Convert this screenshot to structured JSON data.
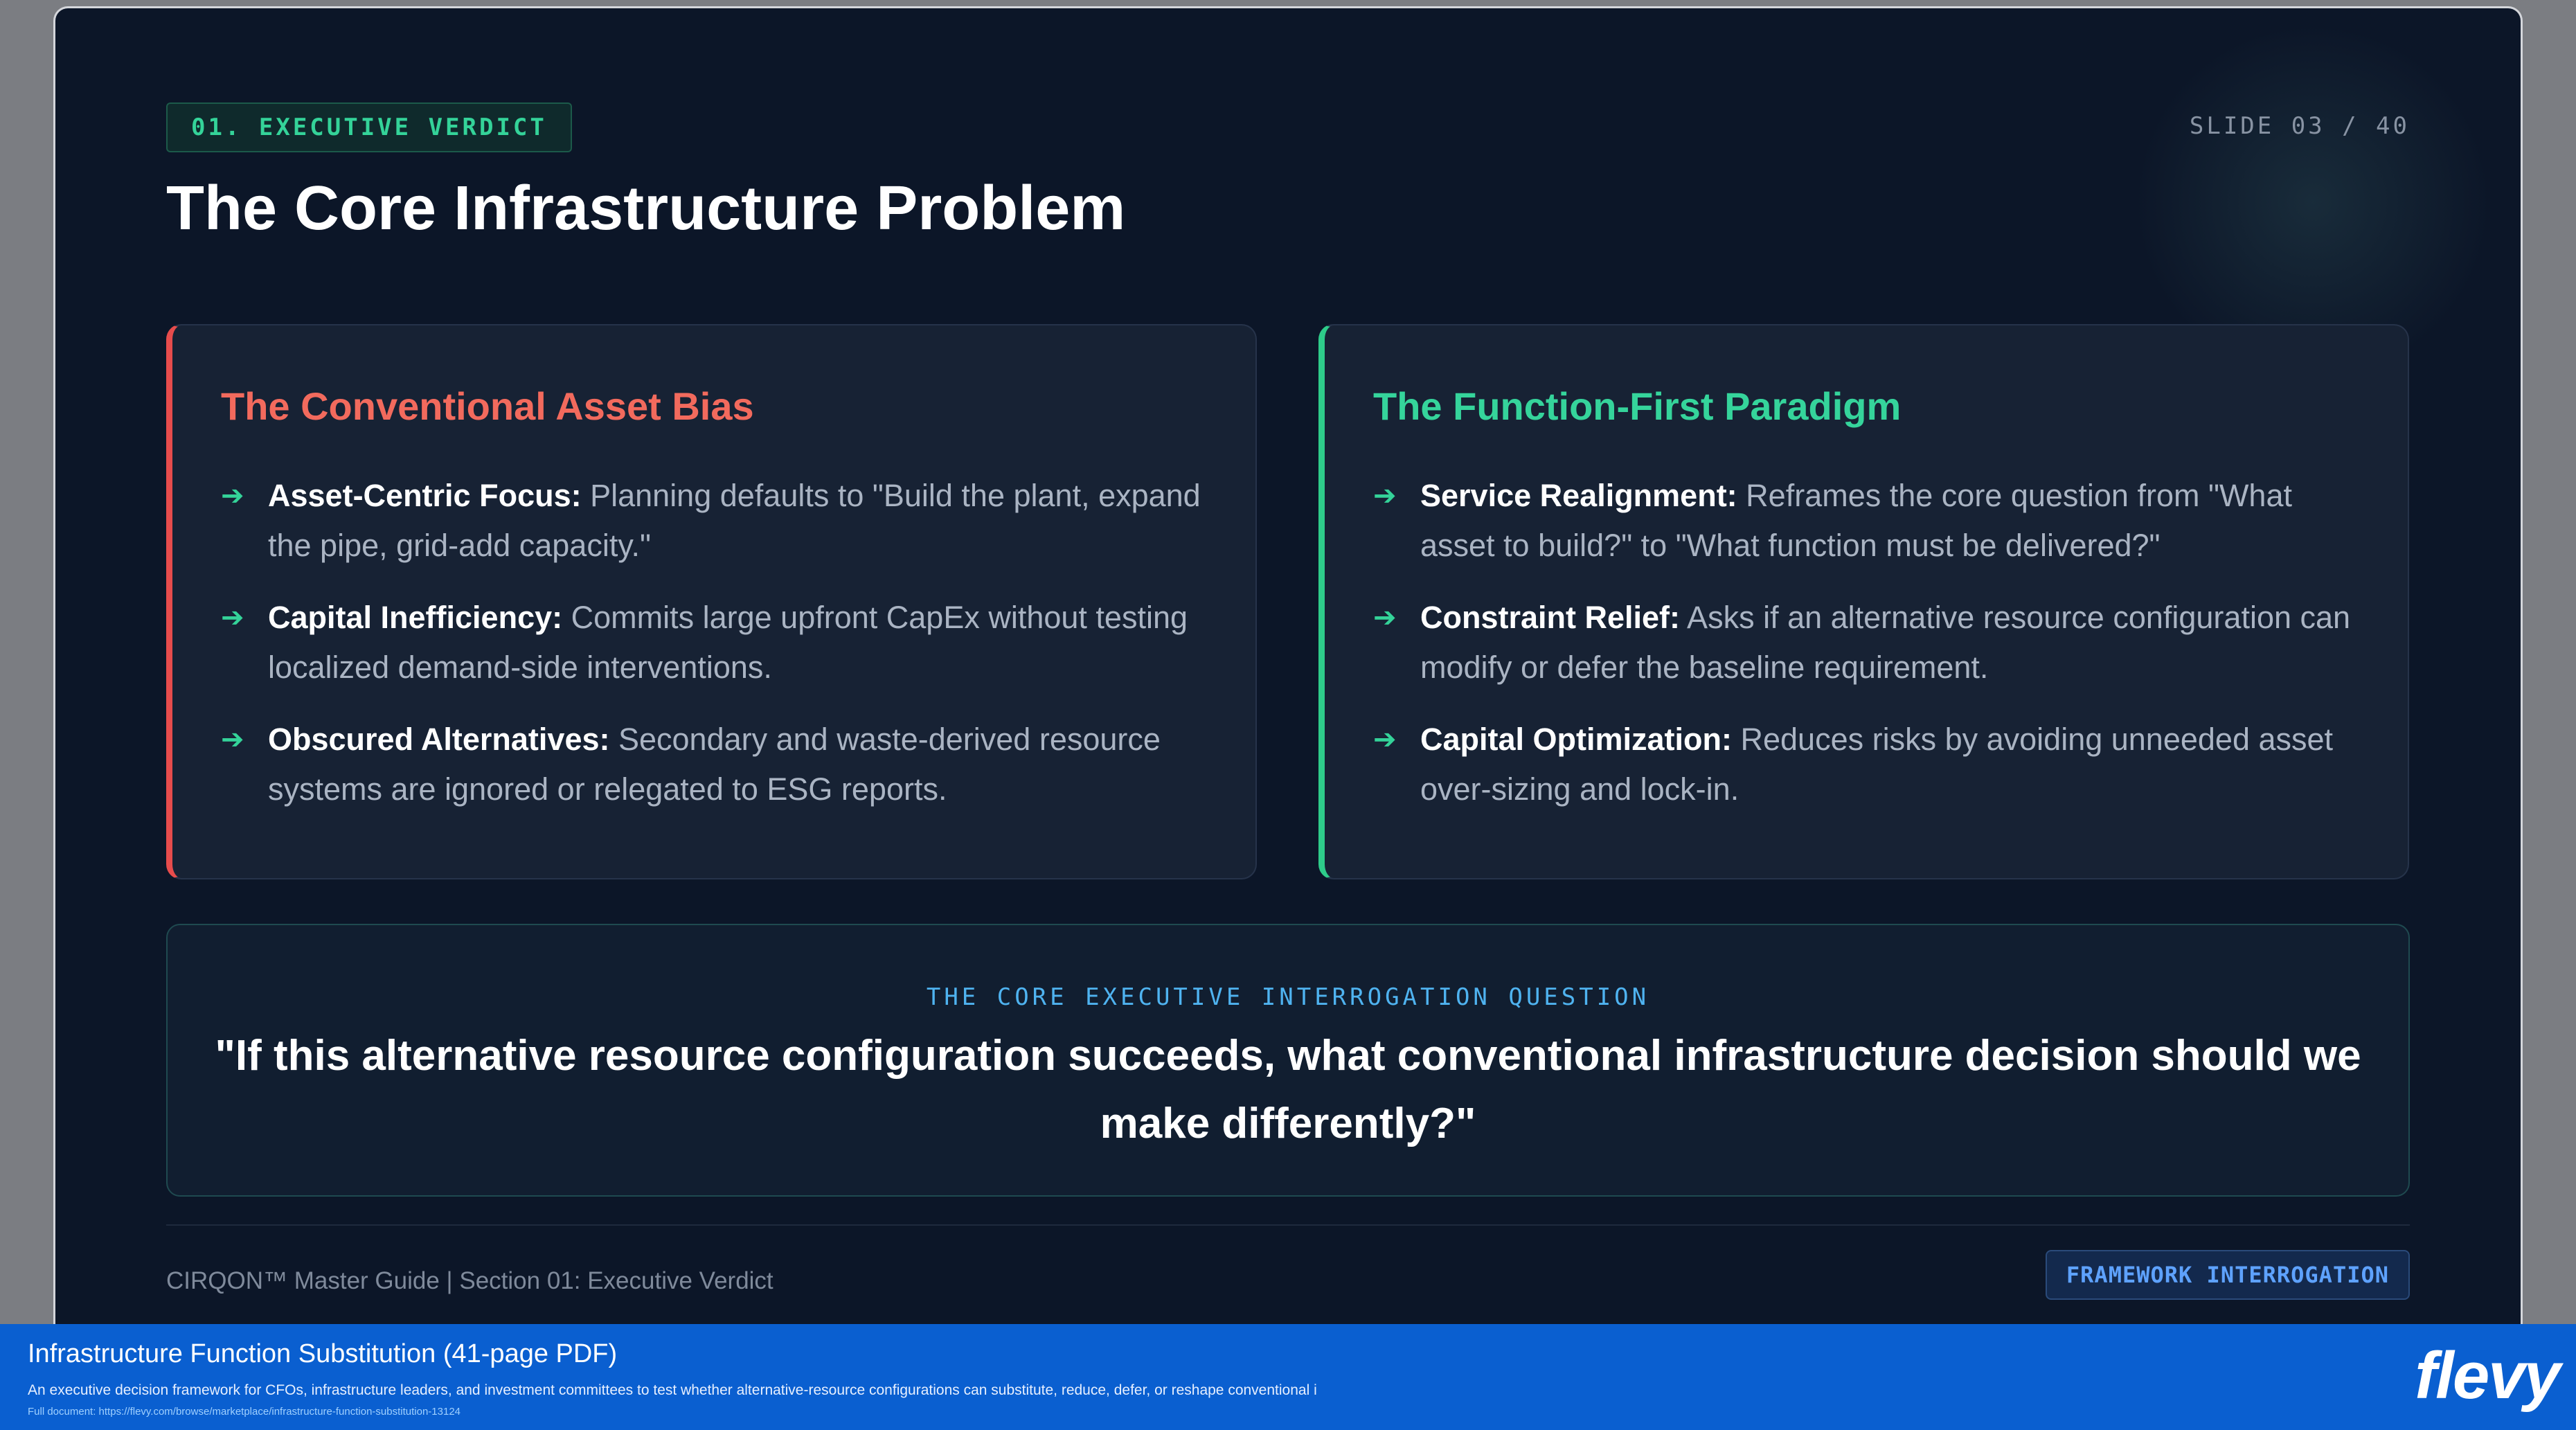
{
  "slide": {
    "tag": "01. EXECUTIVE VERDICT",
    "number": "SLIDE 03 / 40",
    "title": "The Core Infrastructure Problem"
  },
  "left_card": {
    "title": "The Conventional Asset Bias",
    "accent": "#e74c4c",
    "items": [
      {
        "term": "Asset-Centric Focus:",
        "text": " Planning defaults to \"Build the plant, expand the pipe, grid-add capacity.\""
      },
      {
        "term": "Capital Inefficiency:",
        "text": " Commits large upfront CapEx without testing localized demand-side interventions."
      },
      {
        "term": "Obscured Alternatives:",
        "text": " Secondary and waste-derived resource systems are ignored or relegated to ESG reports."
      }
    ]
  },
  "right_card": {
    "title": "The Function-First Paradigm",
    "accent": "#2ecc8a",
    "items": [
      {
        "term": "Service Realignment:",
        "text": " Reframes the core question from \"What asset to build?\" to \"What function must be delivered?\""
      },
      {
        "term": "Constraint Relief:",
        "text": " Asks if an alternative resource configuration can modify or defer the baseline requirement."
      },
      {
        "term": "Capital Optimization:",
        "text": " Reduces risks by avoiding unneeded asset over-sizing and lock-in."
      }
    ]
  },
  "question": {
    "label": "THE CORE EXECUTIVE INTERROGATION QUESTION",
    "text": "\"If this alternative resource configuration succeeds, what conventional infrastructure decision should we make differently?\""
  },
  "footer": {
    "text": "CIRQON™ Master Guide | Section 01: Executive Verdict",
    "badge": "FRAMEWORK INTERROGATION"
  },
  "banner": {
    "title": "Infrastructure Function Substitution",
    "pages": " (41-page PDF)",
    "description": "An executive decision framework for CFOs, infrastructure leaders, and investment committees to test whether alternative-resource configurations can substitute, reduce, defer, or reshape conventional i",
    "link": "Full document: https://flevy.com/browse/marketplace/infrastructure-function-substitution-13124",
    "logo": "flevy"
  },
  "icons": {
    "bullet": "arrow-right-icon"
  }
}
